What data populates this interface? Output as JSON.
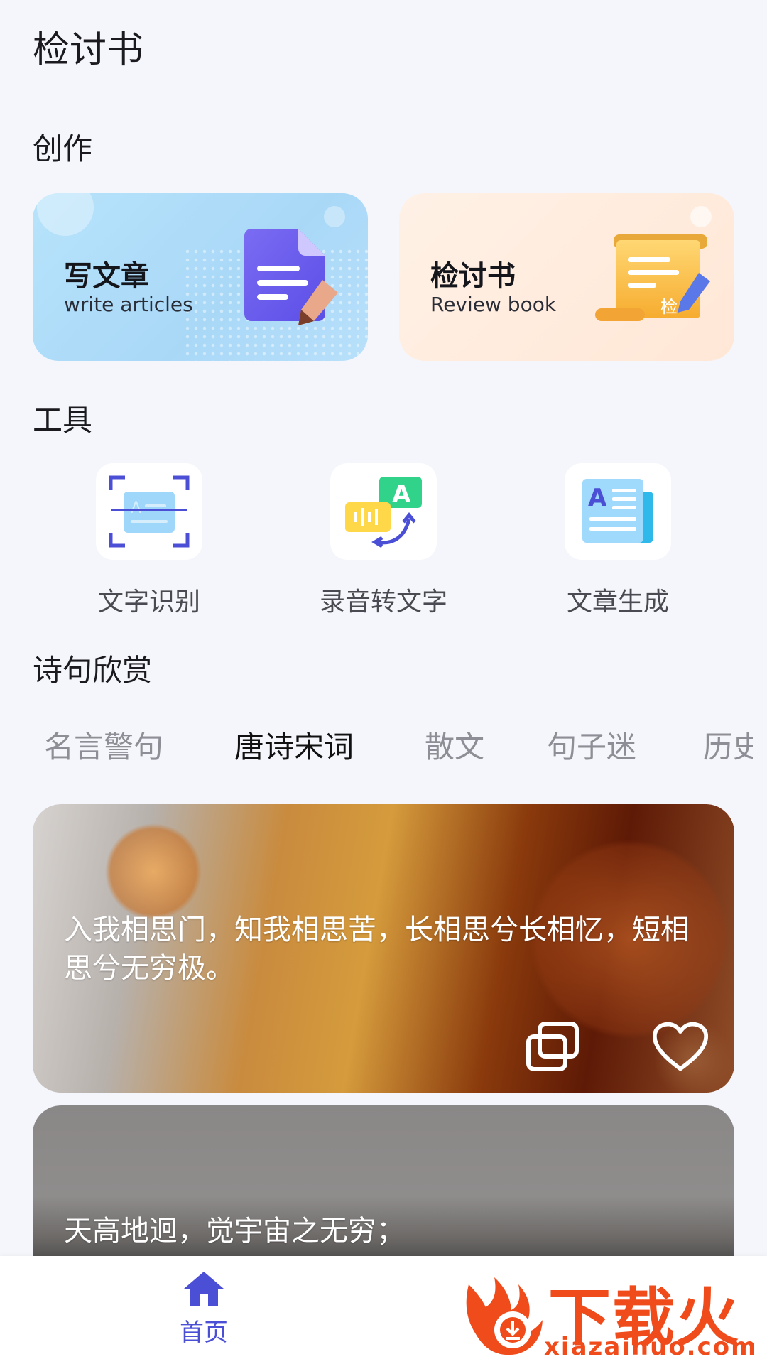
{
  "header": {
    "title": "检讨书"
  },
  "sections": {
    "create": "创作",
    "tools": "工具",
    "poems": "诗句欣赏"
  },
  "create_cards": [
    {
      "title": "写文章",
      "subtitle": "write articles",
      "icon": "document-icon"
    },
    {
      "title": "检讨书",
      "subtitle": "Review book",
      "icon": "scroll-icon"
    }
  ],
  "tools": [
    {
      "label": "文字识别",
      "icon": "text-scan-icon"
    },
    {
      "label": "录音转文字",
      "icon": "voice-to-text-icon"
    },
    {
      "label": "文章生成",
      "icon": "article-generate-icon"
    }
  ],
  "tabs": [
    {
      "label": "名言警句",
      "active": false
    },
    {
      "label": "唐诗宋词",
      "active": true
    },
    {
      "label": "散文",
      "active": false
    },
    {
      "label": "句子迷",
      "active": false
    },
    {
      "label": "历史",
      "active": false
    }
  ],
  "poems": [
    {
      "text": "入我相思门，知我相思苦，长相思兮长相忆，短相思兮无穷极。"
    },
    {
      "text": "天高地迥，觉宇宙之无穷；"
    }
  ],
  "bottom_nav": {
    "home_label": "首页"
  },
  "watermark": {
    "brand": "下载火",
    "url": "xiazaihuo.com"
  },
  "colors": {
    "accent": "#4b4fd6",
    "background": "#f5f6fb",
    "watermark": "#ef4b1b"
  }
}
